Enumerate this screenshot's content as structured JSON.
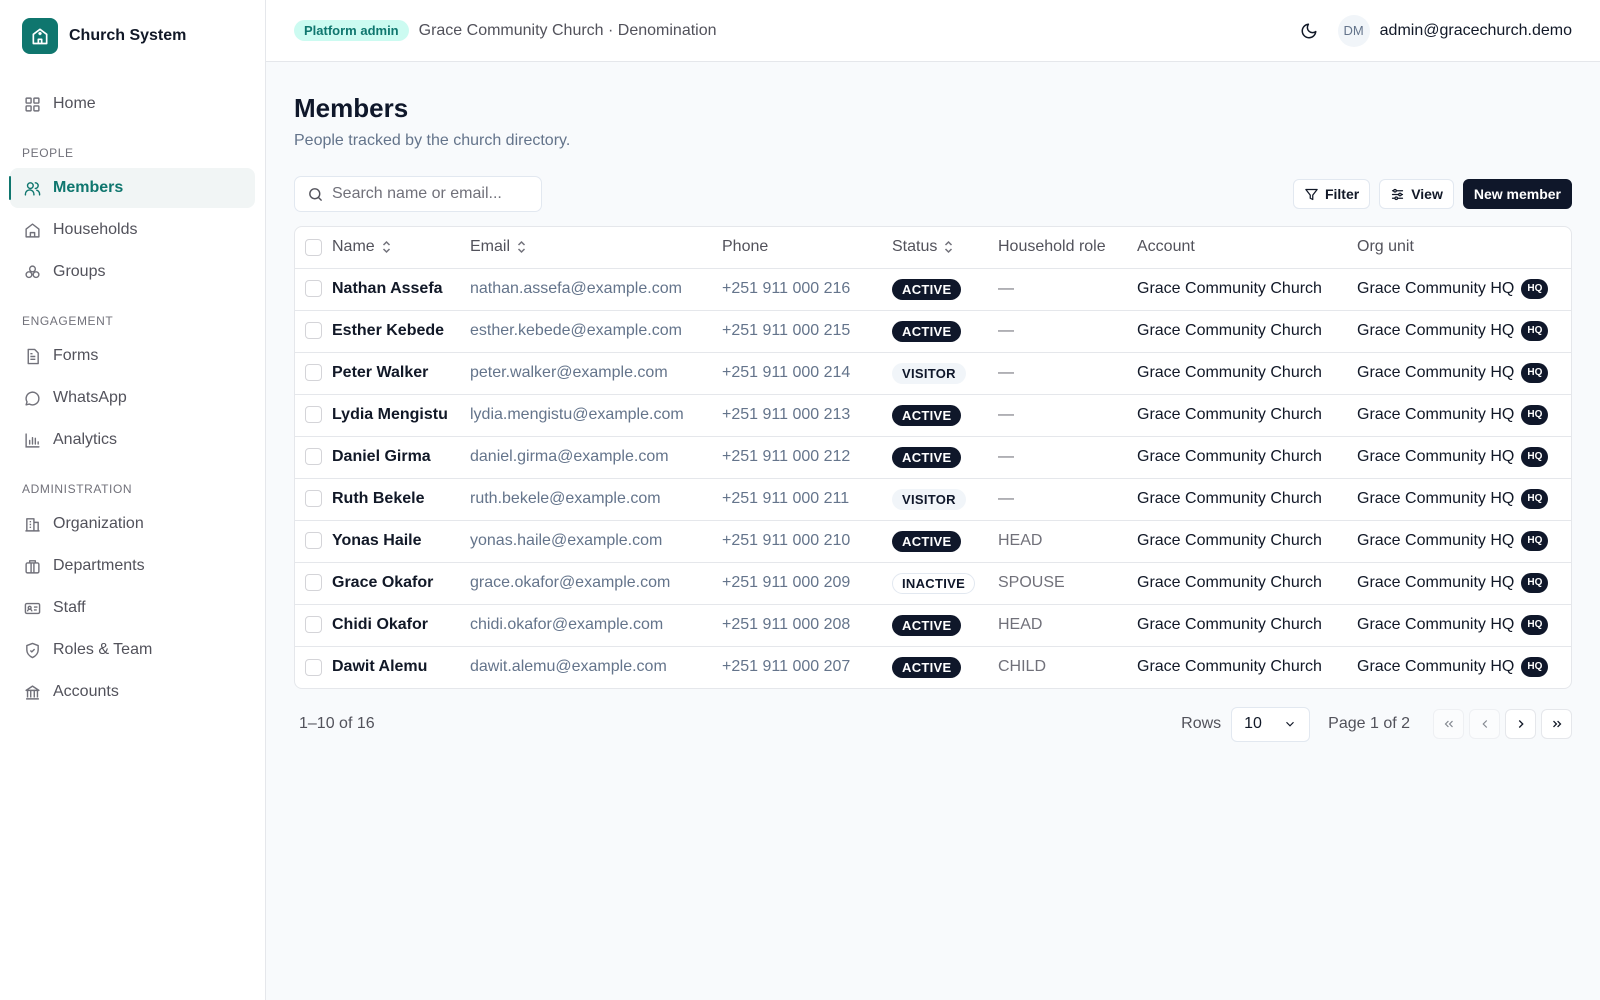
{
  "brand": {
    "name": "Church System"
  },
  "nav": {
    "home": "Home",
    "sections": {
      "people": "PEOPLE",
      "engagement": "ENGAGEMENT",
      "administration": "ADMINISTRATION"
    },
    "people": [
      "Members",
      "Households",
      "Groups"
    ],
    "engagement": [
      "Forms",
      "WhatsApp",
      "Analytics"
    ],
    "administration": [
      "Organization",
      "Departments",
      "Staff",
      "Roles & Team",
      "Accounts"
    ],
    "active": "Members"
  },
  "topbar": {
    "badge": "Platform admin",
    "breadcrumb": "Grace Community Church · Denomination",
    "avatar_initials": "DM",
    "user_email": "admin@gracechurch.demo"
  },
  "page": {
    "title": "Members",
    "subtitle": "People tracked by the church directory."
  },
  "toolbar": {
    "search_placeholder": "Search name or email...",
    "filter_label": "Filter",
    "view_label": "View",
    "new_label": "New member"
  },
  "table": {
    "headers": {
      "name": "Name",
      "email": "Email",
      "phone": "Phone",
      "status": "Status",
      "role": "Household role",
      "account": "Account",
      "org_unit": "Org unit"
    },
    "rows": [
      {
        "name": "Nathan Assefa",
        "email": "nathan.assefa@example.com",
        "phone": "+251 911 000 216",
        "status": "ACTIVE",
        "role": "—",
        "account": "Grace Community Church",
        "org_unit": "Grace Community HQ",
        "tag": "HQ"
      },
      {
        "name": "Esther Kebede",
        "email": "esther.kebede@example.com",
        "phone": "+251 911 000 215",
        "status": "ACTIVE",
        "role": "—",
        "account": "Grace Community Church",
        "org_unit": "Grace Community HQ",
        "tag": "HQ"
      },
      {
        "name": "Peter Walker",
        "email": "peter.walker@example.com",
        "phone": "+251 911 000 214",
        "status": "VISITOR",
        "role": "—",
        "account": "Grace Community Church",
        "org_unit": "Grace Community HQ",
        "tag": "HQ"
      },
      {
        "name": "Lydia Mengistu",
        "email": "lydia.mengistu@example.com",
        "phone": "+251 911 000 213",
        "status": "ACTIVE",
        "role": "—",
        "account": "Grace Community Church",
        "org_unit": "Grace Community HQ",
        "tag": "HQ"
      },
      {
        "name": "Daniel Girma",
        "email": "daniel.girma@example.com",
        "phone": "+251 911 000 212",
        "status": "ACTIVE",
        "role": "—",
        "account": "Grace Community Church",
        "org_unit": "Grace Community HQ",
        "tag": "HQ"
      },
      {
        "name": "Ruth Bekele",
        "email": "ruth.bekele@example.com",
        "phone": "+251 911 000 211",
        "status": "VISITOR",
        "role": "—",
        "account": "Grace Community Church",
        "org_unit": "Grace Community HQ",
        "tag": "HQ"
      },
      {
        "name": "Yonas Haile",
        "email": "yonas.haile@example.com",
        "phone": "+251 911 000 210",
        "status": "ACTIVE",
        "role": "HEAD",
        "account": "Grace Community Church",
        "org_unit": "Grace Community HQ",
        "tag": "HQ"
      },
      {
        "name": "Grace Okafor",
        "email": "grace.okafor@example.com",
        "phone": "+251 911 000 209",
        "status": "INACTIVE",
        "role": "SPOUSE",
        "account": "Grace Community Church",
        "org_unit": "Grace Community HQ",
        "tag": "HQ"
      },
      {
        "name": "Chidi Okafor",
        "email": "chidi.okafor@example.com",
        "phone": "+251 911 000 208",
        "status": "ACTIVE",
        "role": "HEAD",
        "account": "Grace Community Church",
        "org_unit": "Grace Community HQ",
        "tag": "HQ"
      },
      {
        "name": "Dawit Alemu",
        "email": "dawit.alemu@example.com",
        "phone": "+251 911 000 207",
        "status": "ACTIVE",
        "role": "CHILD",
        "account": "Grace Community Church",
        "org_unit": "Grace Community HQ",
        "tag": "HQ"
      }
    ]
  },
  "pagination": {
    "range": "1–10 of 16",
    "rows_label": "Rows",
    "rows_value": "10",
    "page_label": "Page 1 of 2"
  },
  "colors": {
    "accent": "#0f766e",
    "primary_dark": "#0f172a",
    "badge_bg": "#ccfbf1"
  },
  "icons": {
    "brand": "church-icon",
    "home": "grid-icon",
    "members": "users-icon",
    "households": "house-icon",
    "groups": "circles-icon",
    "forms": "document-icon",
    "whatsapp": "chat-bubble-icon",
    "analytics": "bar-chart-icon",
    "organization": "building-icon",
    "departments": "briefcase-icon",
    "staff": "id-card-icon",
    "roles": "shield-check-icon",
    "accounts": "bank-icon",
    "theme": "moon-icon",
    "search": "search-icon",
    "filter": "filter-icon",
    "view": "sliders-icon"
  }
}
